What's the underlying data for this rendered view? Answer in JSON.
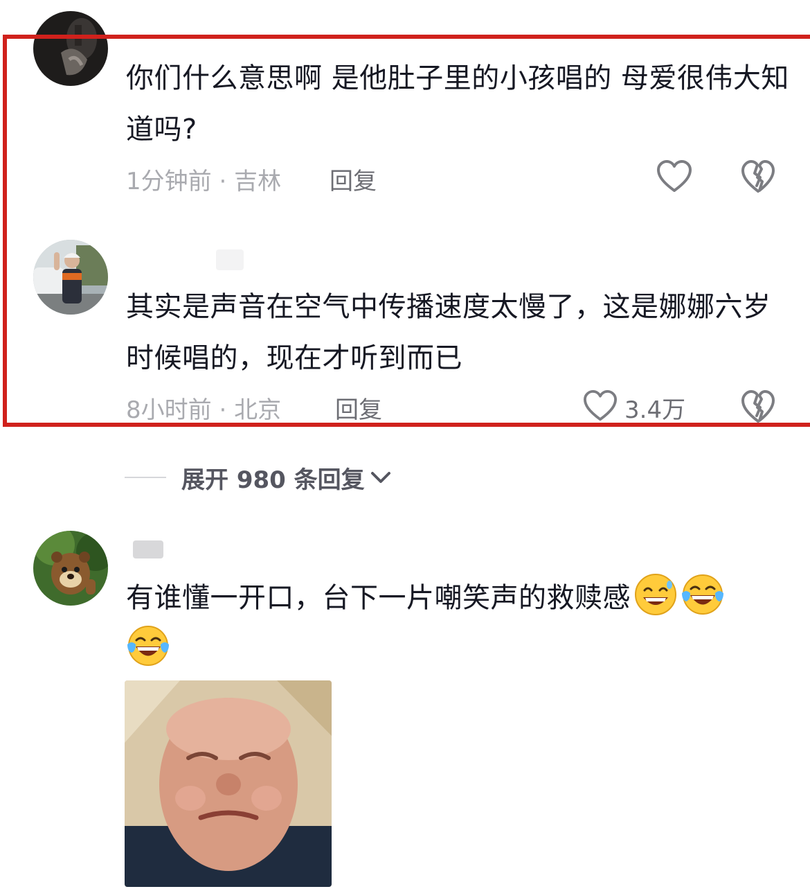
{
  "comments": [
    {
      "username": "",
      "text": "你们什么意思啊 是他肚子里的小孩唱的 母爱很伟大知道吗?",
      "time": "1分钟前",
      "location": "吉林",
      "reply_label": "回复",
      "like_count": ""
    },
    {
      "username": "",
      "text": "其实是声音在空气中传播速度太慢了，这是娜娜六岁时候唱的，现在才听到而已",
      "time": "8小时前",
      "location": "北京",
      "reply_label": "回复",
      "like_count": "3.4万"
    },
    {
      "username": "",
      "text": "有谁懂一开口，台下一片嘲笑声的救赎感",
      "emojis": [
        "grinning-sweat-emoji",
        "tears-of-joy-emoji",
        "tears-of-joy-emoji"
      ],
      "has_image": true
    }
  ],
  "expand": {
    "label": "展开 980 条回复"
  },
  "separator": "·",
  "colors": {
    "highlight": "#d0211c",
    "meta": "#a9aaaf",
    "reply": "#6d6e74",
    "text": "#161823"
  }
}
